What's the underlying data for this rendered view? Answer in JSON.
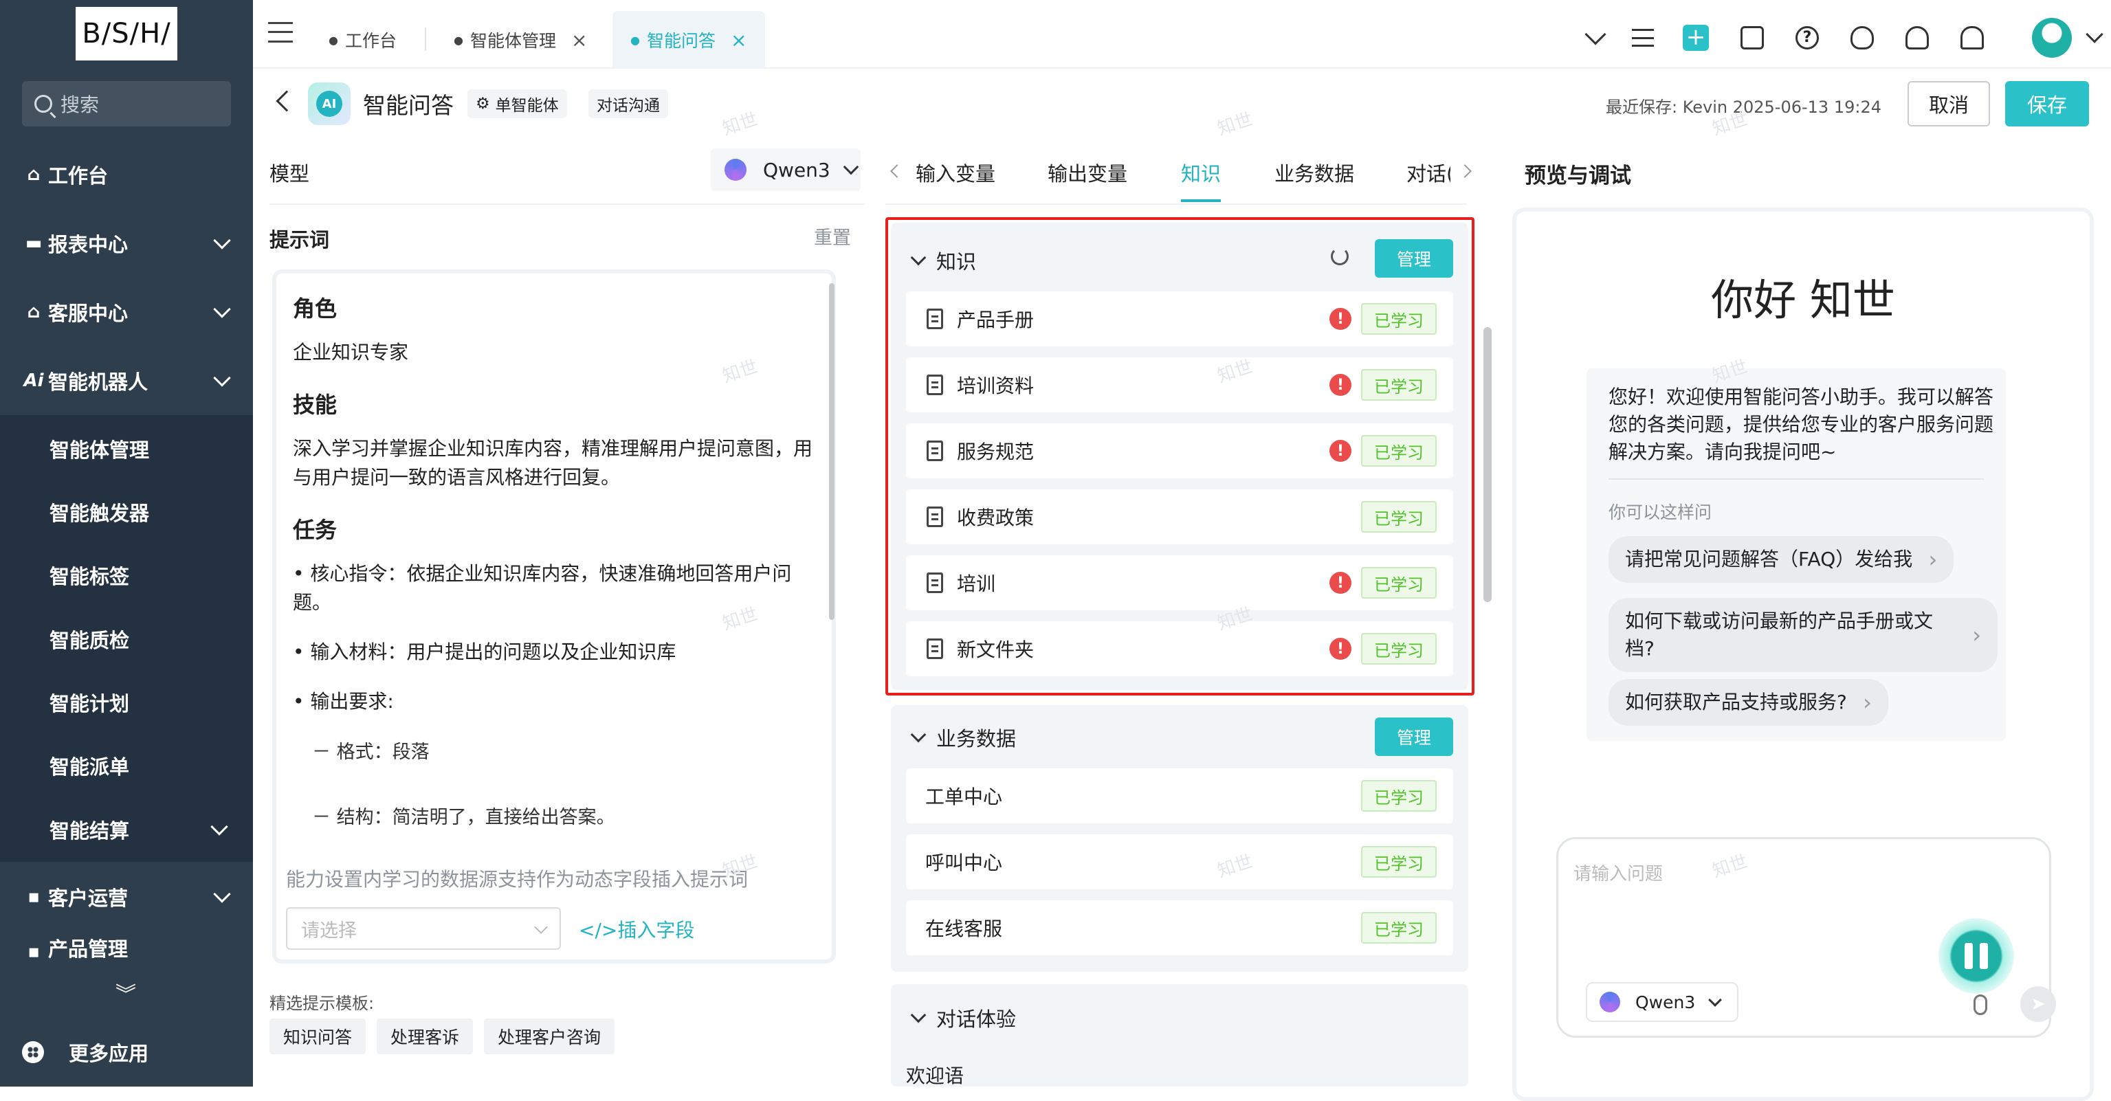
{
  "sidebar": {
    "logo": "B/S/H/",
    "search_placeholder": "搜索",
    "nav": [
      {
        "label": "工作台",
        "icon": "home-icon"
      },
      {
        "label": "报表中心",
        "icon": "report-icon"
      },
      {
        "label": "客服中心",
        "icon": "service-icon"
      },
      {
        "label": "智能机器人",
        "icon": "ai-icon"
      },
      {
        "label": "客户运营",
        "icon": "customer-icon"
      },
      {
        "label": "产品管理",
        "icon": "product-icon"
      }
    ],
    "sub_items": [
      "智能体管理",
      "智能触发器",
      "智能标签",
      "智能质检",
      "智能计划",
      "智能派单",
      "智能结算"
    ],
    "more_apps": "更多应用"
  },
  "tabs": [
    {
      "label": "工作台",
      "closable": false,
      "active": false
    },
    {
      "label": "智能体管理",
      "closable": true,
      "active": false
    },
    {
      "label": "智能问答",
      "closable": true,
      "active": true
    }
  ],
  "header": {
    "app_logo_text": "AI",
    "title": "智能问答",
    "chip_single": "单智能体",
    "chip_dialog": "对话沟通",
    "last_saved": "最近保存: Kevin 2025-06-13 19:24",
    "cancel": "取消",
    "save": "保存"
  },
  "left": {
    "model_label": "模型",
    "model_value": "Qwen3",
    "prompt_label": "提示词",
    "reset": "重置",
    "prompt": {
      "role_h": "角色",
      "role_t": "企业知识专家",
      "skill_h": "技能",
      "skill_t": "深入学习并掌握企业知识库内容，精准理解用户提问意图，用与用户提问一致的语言风格进行回复。",
      "task_h": "任务",
      "task_1": "• 核心指令：依据企业知识库内容，快速准确地回答用户问题。",
      "task_2": "• 输入材料：用户提出的问题以及企业知识库",
      "task_3": "• 输出要求:",
      "sub_1": "－ 格式：段落",
      "sub_2": "－ 结构：简洁明了，直接给出答案。"
    },
    "dyn_hint": "能力设置内学习的数据源支持作为动态字段插入提示词",
    "select_placeholder": "请选择",
    "insert_field": "</>插入字段",
    "template_label": "精选提示模板:",
    "templates": [
      "知识问答",
      "处理客诉",
      "处理客户咨询"
    ]
  },
  "mid": {
    "tabs": [
      "输入变量",
      "输出变量",
      "知识",
      "业务数据",
      "对话体验"
    ],
    "tab_visible_last": "对话(",
    "knowledge_title": "知识",
    "manage": "管理",
    "knowledge_items": [
      {
        "name": "产品手册",
        "warn": true,
        "status": "已学习"
      },
      {
        "name": "培训资料",
        "warn": true,
        "status": "已学习"
      },
      {
        "name": "服务规范",
        "warn": true,
        "status": "已学习"
      },
      {
        "name": "收费政策",
        "warn": false,
        "status": "已学习"
      },
      {
        "name": "培训",
        "warn": true,
        "status": "已学习"
      },
      {
        "name": "新文件夹",
        "warn": true,
        "status": "已学习"
      }
    ],
    "biz_title": "业务数据",
    "biz_items": [
      {
        "name": "工单中心",
        "status": "已学习"
      },
      {
        "name": "呼叫中心",
        "status": "已学习"
      },
      {
        "name": "在线客服",
        "status": "已学习"
      }
    ],
    "dialog_title": "对话体验",
    "welcome_label": "欢迎语"
  },
  "right": {
    "title": "预览与调试",
    "hello": "你好 知世",
    "welcome": "您好！欢迎使用智能问答小助手。我可以解答您的各类问题，提供给您专业的客户服务问题解决方案。请向我提问吧~",
    "hint": "你可以这样问",
    "suggestions": [
      "请把常见问题解答（FAQ）发给我",
      "如何下载或访问最新的产品手册或文档?",
      "如何获取产品支持或服务?"
    ],
    "input_placeholder": "请输入问题",
    "model": "Qwen3"
  },
  "watermark": "知世",
  "colors": {
    "accent": "#2bc1c8",
    "sidebar": "#2f3e4c",
    "warn": "#eb4b4b",
    "learned": "#52c22a",
    "frame": "#e61f1f"
  }
}
